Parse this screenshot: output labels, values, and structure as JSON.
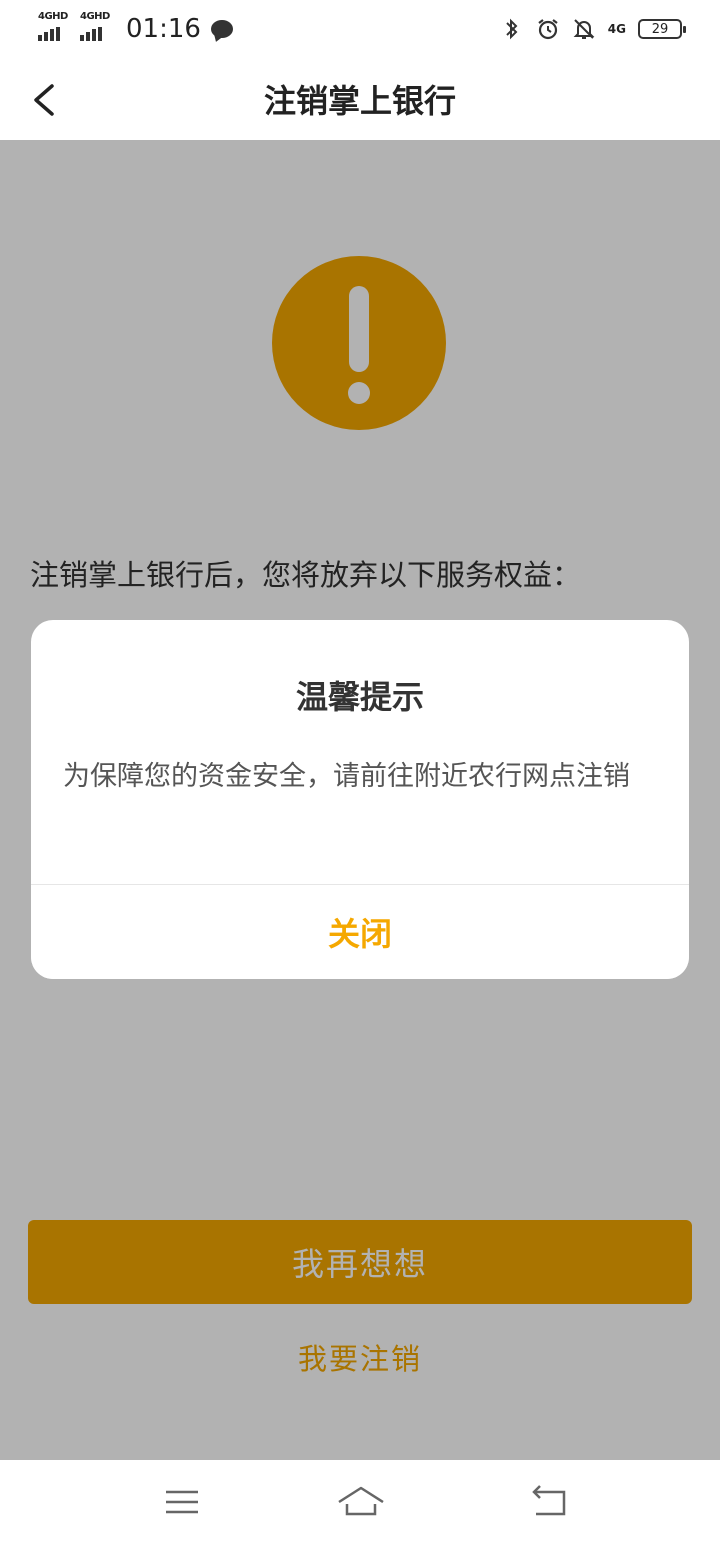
{
  "status_bar": {
    "signal1_label": "4GHD",
    "signal2_label": "4GHD",
    "time": "01:16",
    "net_label": "4G",
    "battery": "29"
  },
  "header": {
    "title": "注销掌上银行"
  },
  "content": {
    "intro": "注销掌上银行后，您将放弃以下服务权益：",
    "primary_button": "我再想想",
    "secondary_link": "我要注销"
  },
  "dialog": {
    "title": "温馨提示",
    "message": "为保障您的资金安全，请前往附近农行网点注销",
    "close_button": "关闭"
  },
  "colors": {
    "accent": "#f2a600"
  }
}
